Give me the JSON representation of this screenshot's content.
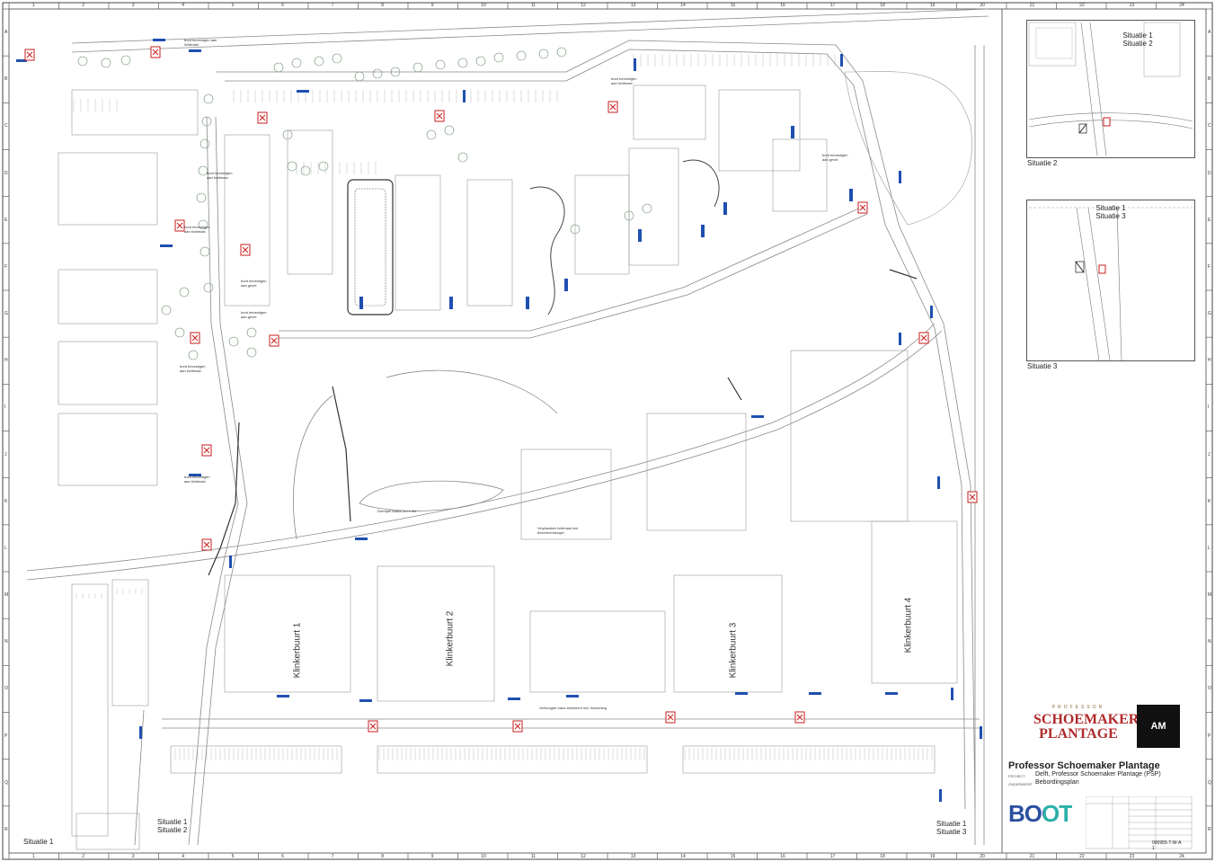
{
  "colors": {
    "line": "#7a7a7a",
    "heavy": "#2b2b2b",
    "sign_blue": "#1f4fb0",
    "sign_red": "#c81e1e",
    "tree": "#6a8a6a",
    "boot_blue": "#2a4fa0",
    "boot_teal": "#2ab0a8"
  },
  "grid": {
    "columns": [
      "1",
      "2",
      "3",
      "4",
      "5",
      "6",
      "7",
      "8",
      "9",
      "10",
      "11",
      "12",
      "13",
      "14",
      "15",
      "16",
      "17",
      "18",
      "19",
      "20",
      "21",
      "22",
      "23",
      "24"
    ],
    "rows": [
      "A",
      "B",
      "C",
      "D",
      "E",
      "F",
      "G",
      "H",
      "I",
      "J",
      "K",
      "L",
      "M",
      "N",
      "O",
      "P",
      "Q",
      "R"
    ]
  },
  "streets": {
    "k1": "Klinkerbuurt 1",
    "k2": "Klinkerbuurt 2",
    "k3": "Klinkerbuurt 3",
    "k4": "Klinkerbuurt 4"
  },
  "annotations": {
    "a1": "bord bevestigen aan lichtmast",
    "a2": "bord bevestigen aan lichtmast",
    "a3": "bord bevestigen aan lichtmast",
    "a4": "bord bevestigen aan gevel",
    "a5": "bord bevestigen aan gevel",
    "a6": "bord bevestigen aan lichtmast",
    "a7": "bord bevestigen aan lichtmast",
    "a8": "bord bevestigen aan lichtmast",
    "a9": "bord bevestigen aan gevel",
    "a10": "Drempel haaks 2m x 4m",
    "a11": "Verplaatsen lichtmast incl. beschermbeugel",
    "a12": "Verhoogde band stelement incl. bebording"
  },
  "insets": {
    "s2_line1": "Situatie 1",
    "s2_line2": "Situatie 2",
    "s2_caption": "Situatie 2",
    "s3_line1": "Situatie 1",
    "s3_line2": "Situatie 3",
    "s3_caption": "Situatie 3"
  },
  "map_labels": {
    "situatie1": "Situatie 1",
    "sit12_line1": "Situatie 1",
    "sit12_line2": "Situatie 2",
    "sit13_line1": "Situatie 1",
    "sit13_line2": "Situatie 3"
  },
  "title_block": {
    "logo_small": "PROFESSOR",
    "logo_line1": "SCHOEMAKER",
    "logo_line2": "PLANTAGE",
    "am_logo": "AM",
    "project_title": "Professor Schoemaker Plantage",
    "project_label": "PROJECT",
    "project_value": "Delft, Professor Schoemaker Plantage (PSP)",
    "subject_label": "ONDERWERP",
    "subject_value": "Bebordingsplan",
    "company": "BOOT",
    "drawing_number": "000955-T-W-A",
    "sheet": "1"
  }
}
